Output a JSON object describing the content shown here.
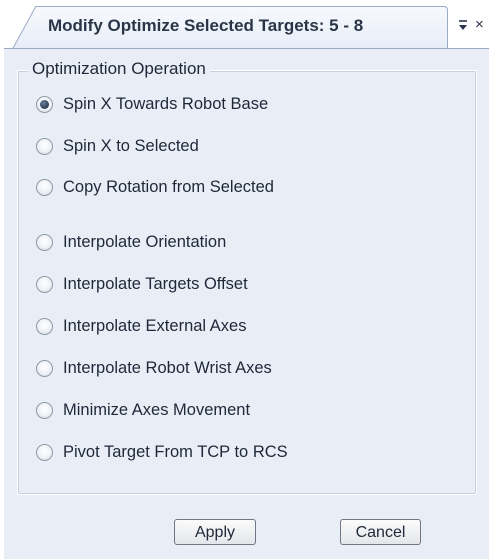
{
  "tab": {
    "title": "Modify Optimize Selected Targets: 5 - 8",
    "pin_icon": "dropdown-pin-icon",
    "close_glyph": "×"
  },
  "group": {
    "title": "Optimization Operation"
  },
  "options": [
    {
      "label": "Spin X Towards Robot Base",
      "checked": true
    },
    {
      "label": "Spin X to Selected",
      "checked": false
    },
    {
      "label": "Copy Rotation from Selected",
      "checked": false
    },
    {
      "label": "Interpolate Orientation",
      "checked": false
    },
    {
      "label": "Interpolate Targets Offset",
      "checked": false
    },
    {
      "label": "Interpolate External Axes",
      "checked": false
    },
    {
      "label": "Interpolate Robot Wrist Axes",
      "checked": false
    },
    {
      "label": "Minimize Axes Movement",
      "checked": false
    },
    {
      "label": "Pivot Target From TCP to RCS",
      "checked": false
    }
  ],
  "buttons": {
    "apply": "Apply",
    "cancel": "Cancel"
  },
  "colors": {
    "panel_background": "#e9eef6",
    "border": "#9aaac6"
  }
}
